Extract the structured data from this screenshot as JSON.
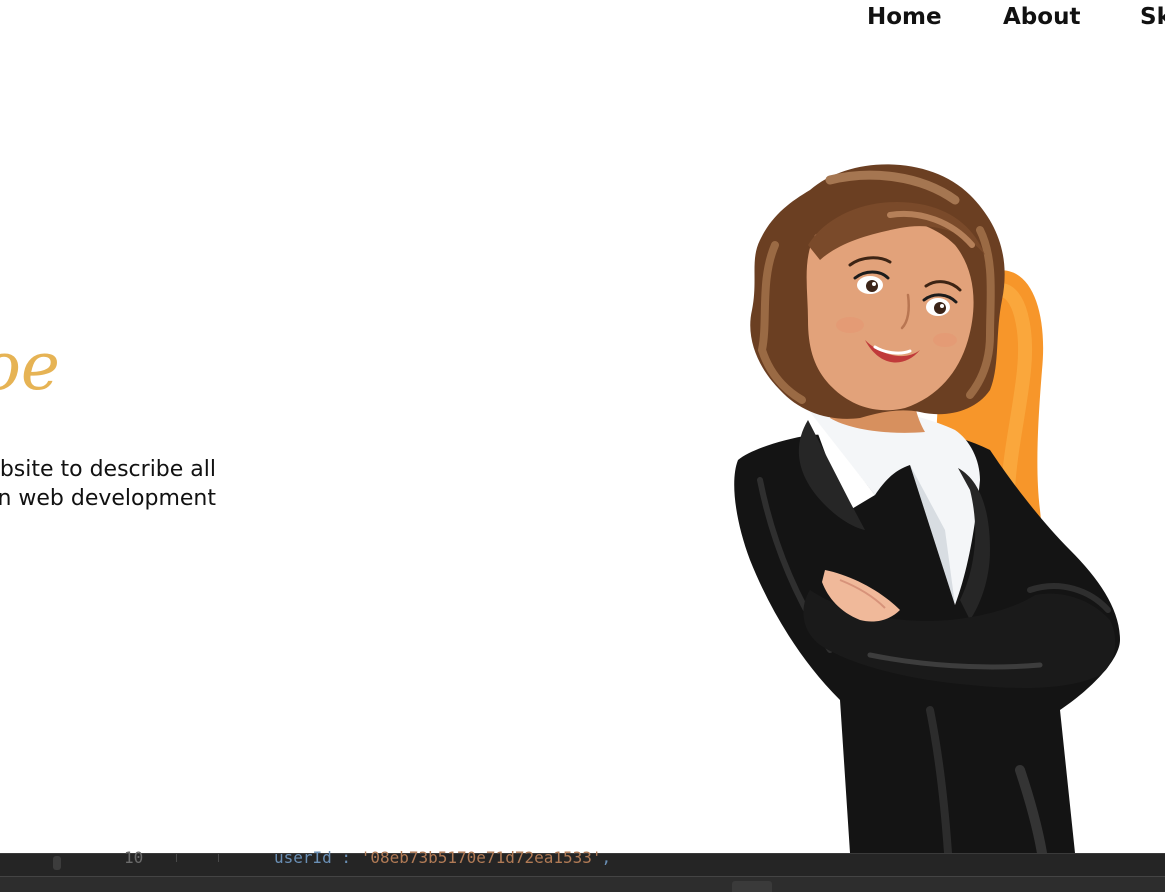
{
  "nav": {
    "links": [
      {
        "label": "Home"
      },
      {
        "label": "About"
      },
      {
        "label": "Sk"
      }
    ]
  },
  "hero": {
    "name": "Joe",
    "description_lines": [
      "bsite to describe all",
      "n web development"
    ]
  },
  "editor": {
    "line_number": "10",
    "code_key": "userId",
    "code_colon": " : ",
    "code_value": "'08eb73b5170e71d72ea1533'",
    "code_trailing": ","
  },
  "colors": {
    "accent_name": "#e6b354",
    "blob": "#f7962a",
    "editor_bg": "#1e1e1e"
  },
  "icons": {
    "illustration": "businesswoman-illustration"
  }
}
